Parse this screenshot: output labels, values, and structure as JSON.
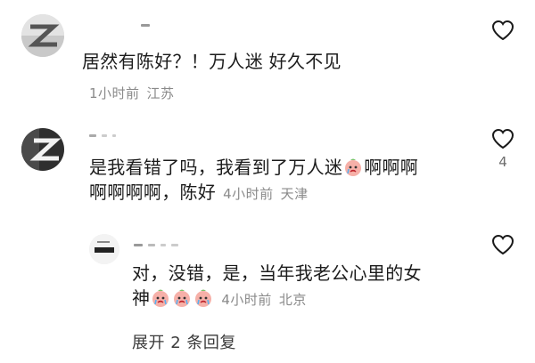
{
  "comments": [
    {
      "text": "居然有陈好？！万人迷 好久不见",
      "time": "1小时前",
      "location": "江苏",
      "like_count": ""
    },
    {
      "text_line1": "是我看错了吗，我看到了万人迷",
      "text_line1_end": "啊啊啊",
      "text_line2": "啊啊啊啊，陈好",
      "time": "4小时前",
      "location": "天津",
      "like_count": "4"
    }
  ],
  "reply": {
    "text_line1": "对，没错，是，当年我老公心里的女",
    "text_line2": "神",
    "time": "4小时前",
    "location": "北京",
    "like_count": "",
    "emoji_name": "crying-peach-emoji"
  },
  "expand_replies": "展开 2 条回复",
  "colors": {
    "text": "#1c1c1c",
    "meta": "#8a8a8a",
    "icon_stroke": "#1a1a1a"
  }
}
